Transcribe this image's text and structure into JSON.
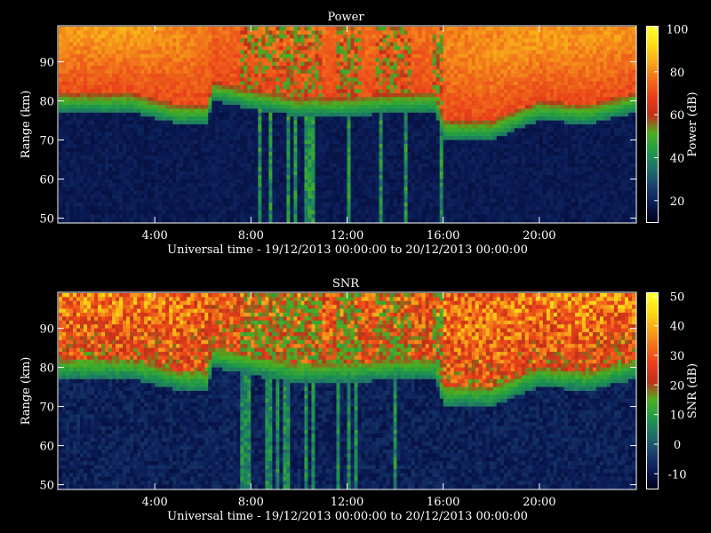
{
  "colors": {
    "background": "#000000",
    "colormap": [
      "#00001a",
      "#0a1a55",
      "#1a3f6e",
      "#1f6f6a",
      "#1f9a4a",
      "#4cb020",
      "#c0301a",
      "#e83e1a",
      "#f06c1a",
      "#f8a81a",
      "#ffdf10",
      "#ffff33"
    ]
  },
  "chart_data": [
    {
      "type": "heatmap",
      "title": "Power",
      "xlabel": "Universal time - 19/12/2013 00:00:00 to 20/12/2013 00:00:00",
      "ylabel": "Range (km)",
      "colorbar_label": "Power (dB)",
      "x_ticks": [
        "4:00",
        "8:00",
        "12:00",
        "16:00",
        "20:00"
      ],
      "x_tick_hours": [
        4,
        8,
        12,
        16,
        20
      ],
      "xlim_hours": [
        0,
        24
      ],
      "y_ticks": [
        "50",
        "60",
        "70",
        "80",
        "90"
      ],
      "ylim": [
        49,
        99
      ],
      "clim": [
        10,
        101
      ],
      "colorbar_ticks": [
        "20",
        "40",
        "60",
        "80",
        "100"
      ],
      "colorbar_tick_values": [
        20,
        40,
        60,
        80,
        100
      ],
      "boundary_hours": [
        0,
        3,
        5,
        6.2,
        6.4,
        8,
        10,
        12,
        14,
        15.7,
        16,
        18,
        20,
        22,
        24
      ],
      "boundary_km": [
        77,
        77,
        74,
        74,
        80,
        78,
        76,
        76,
        77,
        77,
        70,
        70,
        75,
        74,
        77
      ],
      "top_strength": [
        0.9,
        0.95,
        0.7,
        0.5,
        0.4,
        0.45,
        0.5,
        0.45,
        0.4,
        0.5,
        0.6,
        0.75,
        0.9,
        0.8,
        0.85
      ],
      "high_value_db": 70,
      "low_value_db": 18,
      "disturbed_hours": [
        [
          7.6,
          11
        ],
        [
          11.5,
          12.6
        ],
        [
          13.2,
          14.6
        ],
        [
          15.6,
          16
        ]
      ]
    },
    {
      "type": "heatmap",
      "title": "SNR",
      "xlabel": "Universal time - 19/12/2013 00:00:00 to 20/12/2013 00:00:00",
      "ylabel": "Range (km)",
      "colorbar_label": "SNR (dB)",
      "x_ticks": [
        "4:00",
        "8:00",
        "12:00",
        "16:00",
        "20:00"
      ],
      "x_tick_hours": [
        4,
        8,
        12,
        16,
        20
      ],
      "xlim_hours": [
        0,
        24
      ],
      "y_ticks": [
        "50",
        "60",
        "70",
        "80",
        "90"
      ],
      "ylim": [
        49,
        99
      ],
      "clim": [
        -15,
        51
      ],
      "colorbar_ticks": [
        "-10",
        "0",
        "10",
        "20",
        "30",
        "40",
        "50"
      ],
      "colorbar_tick_values": [
        -10,
        0,
        10,
        20,
        30,
        40,
        50
      ],
      "boundary_hours": [
        0,
        3,
        5,
        6.2,
        6.4,
        8,
        10,
        12,
        14,
        15.7,
        16,
        18,
        20,
        22,
        24
      ],
      "boundary_km": [
        77,
        77,
        74,
        74,
        80,
        78,
        76,
        76,
        77,
        77,
        70,
        70,
        75,
        74,
        77
      ],
      "top_strength": [
        0.8,
        0.85,
        0.7,
        0.5,
        0.4,
        0.45,
        0.5,
        0.45,
        0.4,
        0.5,
        0.6,
        0.7,
        0.8,
        0.75,
        0.8
      ],
      "high_value_db": 25,
      "low_value_db": -8,
      "disturbed_hours": [
        [
          7.6,
          11
        ],
        [
          11.5,
          12.6
        ],
        [
          13.2,
          14.6
        ],
        [
          15.6,
          16
        ]
      ]
    }
  ]
}
